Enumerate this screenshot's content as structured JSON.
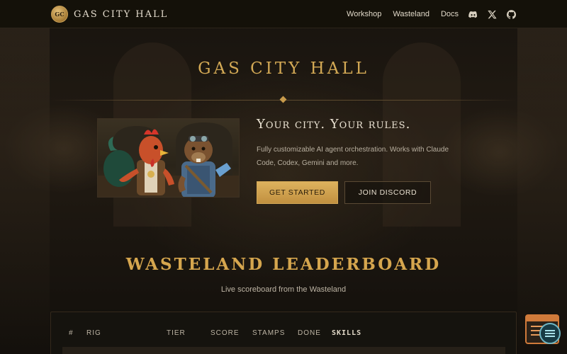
{
  "nav": {
    "logo_text": "GC",
    "brand": "GAS CITY HALL",
    "links": [
      "Workshop",
      "Wasteland",
      "Docs"
    ],
    "icons": [
      "discord-icon",
      "x-icon",
      "github-icon"
    ]
  },
  "hero": {
    "title": "GAS CITY HALL",
    "tagline": "Your city. Your rules.",
    "description": "Fully customizable AI agent orchestration. Works with Claude Code, Codex, Gemini and more.",
    "primary_button": "GET STARTED",
    "secondary_button": "JOIN DISCORD",
    "image_alt": "rooster-and-beaver-illustration"
  },
  "leaderboard": {
    "title": "WASTELAND LEADERBOARD",
    "subtitle": "Live scoreboard from the Wasteland",
    "columns": [
      "#",
      "RIG",
      "TIER",
      "SCORE",
      "STAMPS",
      "DONE",
      "SKILLS"
    ]
  },
  "colors": {
    "accent_gold": "#d3a955",
    "background": "#1a150f",
    "widget_orange": "#d07a3a"
  }
}
